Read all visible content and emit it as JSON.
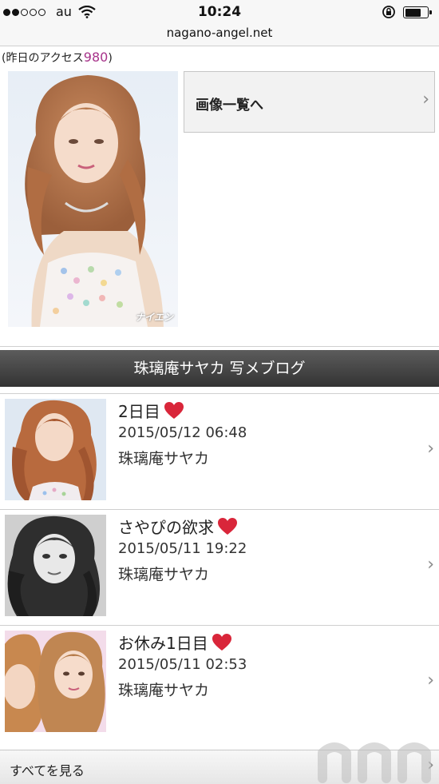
{
  "status_bar": {
    "carrier": "au",
    "time": "10:24",
    "signal_bars_filled": 2,
    "signal_bars_total": 5
  },
  "browser": {
    "url": "nagano-angel.net"
  },
  "access": {
    "prefix": "(昨日のアクセス",
    "count": "980",
    "suffix": ")"
  },
  "profile": {
    "gallery_label": "画像一覧へ",
    "photo_watermark": "ナイエン"
  },
  "blog": {
    "header": "珠璃庵サヤカ 写メブログ",
    "entries": [
      {
        "title": "2日目",
        "date": "2015/05/12 06:48",
        "author": "珠璃庵サヤカ"
      },
      {
        "title": "さやぴの欲求",
        "date": "2015/05/11 19:22",
        "author": "珠璃庵サヤカ"
      },
      {
        "title": "お休み1日目",
        "date": "2015/05/11 02:53",
        "author": "珠璃庵サヤカ"
      }
    ],
    "see_all_label": "すべてを見る"
  },
  "watermark_logo": "nnn",
  "colors": {
    "access_count": "#a7338a",
    "header_bg": "#444444",
    "heart": "#d9263a"
  }
}
